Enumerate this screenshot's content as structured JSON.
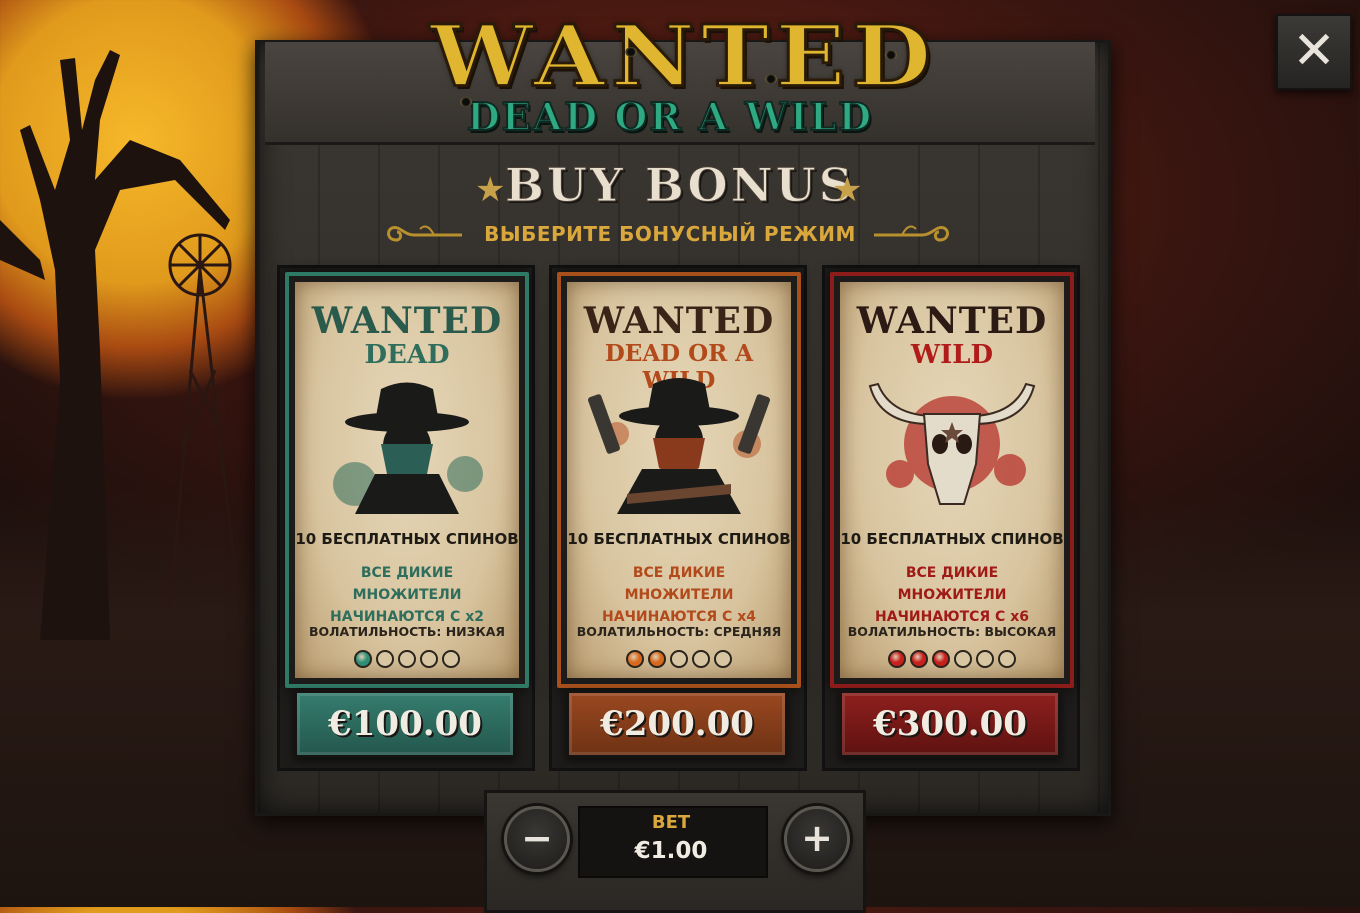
{
  "logo": {
    "main": "WANTED",
    "sub": "DEAD OR A WILD"
  },
  "header": {
    "title": "BUY BONUS",
    "subtitle": "ВЫБЕРИТЕ БОНУСНЫЙ РЕЖИМ",
    "star_icon": "★"
  },
  "close": {
    "icon": "close-icon",
    "glyph": "✕"
  },
  "cards": [
    {
      "title": "WANTED",
      "sub": "DEAD",
      "spins": "10 БЕСПЛАТНЫХ СПИНОВ",
      "mult_line1": "ВСЕ ДИКИЕ МНОЖИТЕЛИ",
      "mult_line2": "НАЧИНАЮТСЯ С x2",
      "volatility_label": "ВОЛАТИЛЬНОСТЬ:",
      "volatility_value": "НИЗКАЯ",
      "volatility_level": 1,
      "volatility_max": 5,
      "price": "€100.00",
      "accent": "#2f7a66",
      "sub_color": "#2f6e5c",
      "mult_color": "#2f6e5c",
      "dot_color": "#2f8f76",
      "title_color": "#2a5a4c",
      "btn_color": "#2b6e61",
      "icon": "bandit-icon"
    },
    {
      "title": "WANTED",
      "sub": "DEAD OR A WILD",
      "spins": "10 БЕСПЛАТНЫХ СПИНОВ",
      "mult_line1": "ВСЕ ДИКИЕ МНОЖИТЕЛИ",
      "mult_line2": "НАЧИНАЮТСЯ С x4",
      "volatility_label": "ВОЛАТИЛЬНОСТЬ:",
      "volatility_value": "СРЕДНЯЯ",
      "volatility_level": 2,
      "volatility_max": 5,
      "price": "€200.00",
      "accent": "#a8501c",
      "sub_color": "#b24a1c",
      "mult_color": "#b24a1c",
      "dot_color": "#d8691c",
      "title_color": "#3a2418",
      "btn_color": "#8a3e18",
      "icon": "gunslinger-icon"
    },
    {
      "title": "WANTED",
      "sub": "WILD",
      "spins": "10 БЕСПЛАТНЫХ СПИНОВ",
      "mult_line1": "ВСЕ ДИКИЕ МНОЖИТЕЛИ",
      "mult_line2": "НАЧИНАЮТСЯ С x6",
      "volatility_label": "ВОЛАТИЛЬНОСТЬ:",
      "volatility_value": "ВЫСОКАЯ",
      "volatility_level": 3,
      "volatility_max": 6,
      "price": "€300.00",
      "accent": "#8e1c1a",
      "sub_color": "#b01c1a",
      "mult_color": "#a01a18",
      "dot_color": "#c8201c",
      "title_color": "#2c1a14",
      "btn_color": "#7e1a18",
      "icon": "bull-skull-icon"
    }
  ],
  "bet": {
    "label": "BET",
    "value": "€1.00",
    "minus": "−",
    "plus": "+"
  }
}
